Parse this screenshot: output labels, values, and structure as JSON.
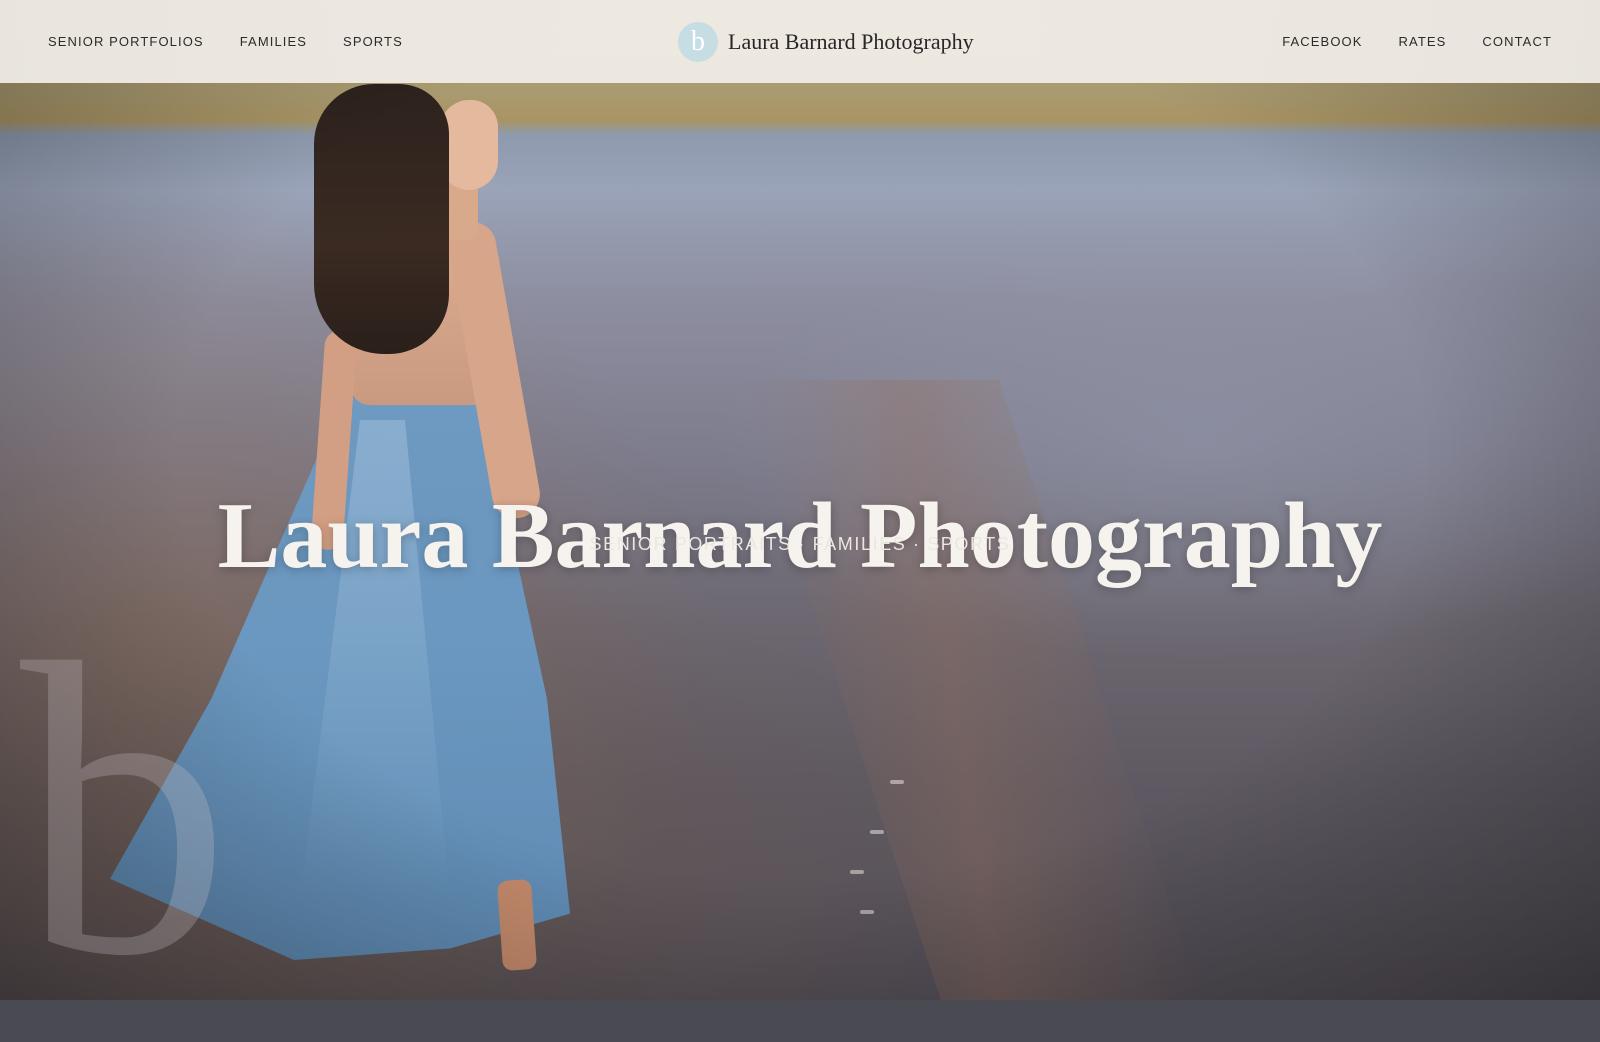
{
  "nav": {
    "left": [
      {
        "label": "SENIOR PORTFOLIOS"
      },
      {
        "label": "FAMILIES"
      },
      {
        "label": "SPORTS"
      }
    ],
    "right": [
      {
        "label": "FACEBOOK"
      },
      {
        "label": "RATES"
      },
      {
        "label": "CONTACT"
      }
    ],
    "brand": {
      "logo_letter": "b",
      "name": "Laura Barnard Photography"
    }
  },
  "hero": {
    "title": "Laura Barnard Photography",
    "subtitle": "SENIOR PORTRAITS · FAMILIES · SPORTS",
    "watermark_letter": "b",
    "image": "beach-portrait-woman-blue-dress"
  },
  "colors": {
    "nav_bg": "#f1eee8",
    "logo_bg": "#c7dde4",
    "title_text": "#f6f3ee",
    "nav_text": "#2c2a2b"
  }
}
